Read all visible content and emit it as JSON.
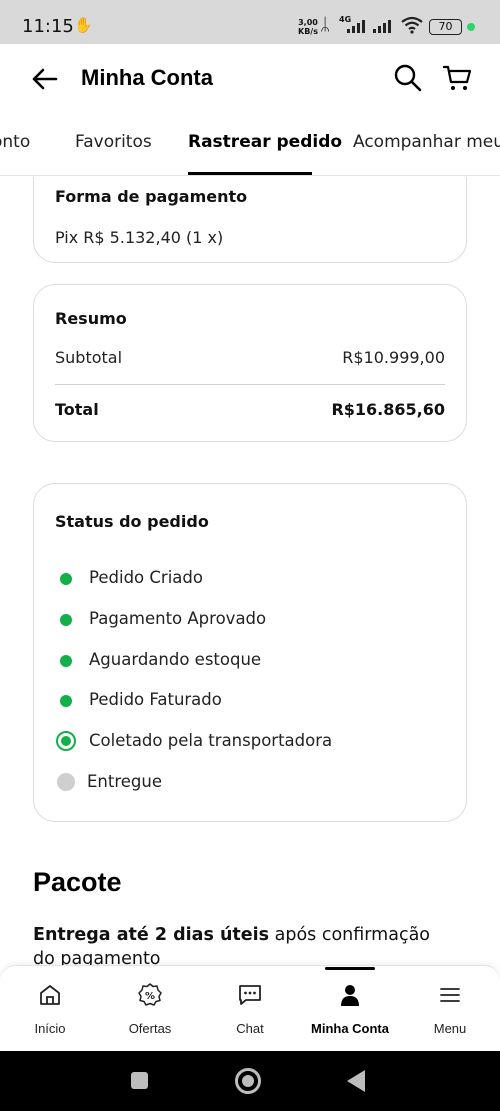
{
  "status_bar": {
    "time": "11:15",
    "speed_value": "3,00",
    "speed_unit": "KB/s",
    "network": "4G",
    "battery": "70"
  },
  "header": {
    "title": "Minha Conta"
  },
  "tabs": [
    {
      "label": "onto"
    },
    {
      "label": "Favoritos"
    },
    {
      "label": "Rastrear pedido",
      "active": true
    },
    {
      "label": "Acompanhar meu r"
    }
  ],
  "payment": {
    "label": "Forma de pagamento",
    "value": "Pix R$ 5.132,40 (1 x)"
  },
  "summary": {
    "title": "Resumo",
    "subtotal_label": "Subtotal",
    "subtotal_value": "R$10.999,00",
    "total_label": "Total",
    "total_value": "R$16.865,60"
  },
  "order_status": {
    "title": "Status do pedido",
    "steps": [
      {
        "label": "Pedido Criado",
        "state": "done"
      },
      {
        "label": "Pagamento Aprovado",
        "state": "done"
      },
      {
        "label": "Aguardando estoque",
        "state": "done"
      },
      {
        "label": "Pedido Faturado",
        "state": "done"
      },
      {
        "label": "Coletado pela transportadora",
        "state": "current"
      },
      {
        "label": "Entregue",
        "state": "pending"
      }
    ]
  },
  "package": {
    "title": "Pacote",
    "delivery_bold": "Entrega até 2 dias úteis",
    "delivery_rest": " após confirmação do pagamento"
  },
  "bottom_nav": [
    {
      "label": "Início",
      "icon": "home-icon"
    },
    {
      "label": "Ofertas",
      "icon": "offers-icon"
    },
    {
      "label": "Chat",
      "icon": "chat-icon"
    },
    {
      "label": "Minha Conta",
      "icon": "person-icon",
      "active": true
    },
    {
      "label": "Menu",
      "icon": "menu-icon"
    }
  ],
  "colors": {
    "status_green": "#12b04a",
    "pending_gray": "#cfcfcf",
    "statusbar_bg": "#d9d9d9"
  }
}
